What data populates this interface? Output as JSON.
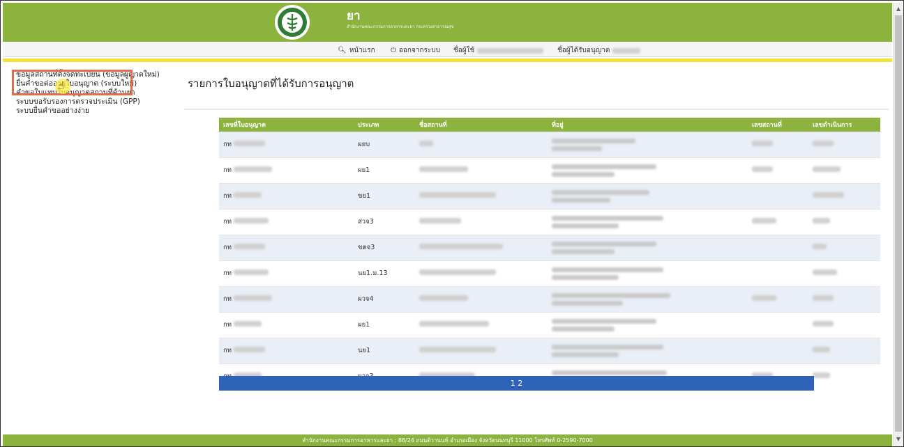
{
  "header": {
    "title": "ยา",
    "subtitle": "สำนักงานคณะกรรมการอาหารและยา กระทรวงสาธารณสุข"
  },
  "nav": {
    "home": "หน้าแรก",
    "logout": "ออกจากระบบ",
    "user_label": "ชื่อผู้ใช้",
    "licensee_label": "ชื่อผู้ได้รับอนุญาต",
    "icon_home": "search-icon",
    "icon_logout": "power-icon"
  },
  "sidebar": {
    "items": [
      {
        "label": "ข้อมูลสถานที่ตั้งจดทะเบียน (ข้อมูลผู้ญาตใหม่)"
      },
      {
        "label": "ยื่นคำขอต่ออายุใบอนุญาต (ระบบใหม่)"
      },
      {
        "label": "คำขอใบแทนใบอนุญาตสถานที่ด้านยา"
      },
      {
        "label": "ระบบขอรับรองการตรวจประเมิน (GPP)"
      },
      {
        "label": "ระบบยื่นคำขออย่างง่าย"
      }
    ]
  },
  "page_title": "รายการใบอนุญาตที่ได้รับการอนุญาต",
  "table": {
    "headers": [
      "เลขที่ใบอนุญาต",
      "ประเภท",
      "ชื่อสถานที่",
      "ที่อยู่",
      "เลขสถานที่",
      "เลขดำเนินการ"
    ],
    "rows": [
      {
        "license_prefix": "กท",
        "type": "ผยบ"
      },
      {
        "license_prefix": "กท",
        "type": "ผย1"
      },
      {
        "license_prefix": "กท",
        "type": "ขย1"
      },
      {
        "license_prefix": "กท",
        "type": "สวจ3"
      },
      {
        "license_prefix": "กท",
        "type": "ขตจ3"
      },
      {
        "license_prefix": "กท",
        "type": "นย1.ม.13"
      },
      {
        "license_prefix": "กท",
        "type": "ผวจ4"
      },
      {
        "license_prefix": "กท",
        "type": "ผย1"
      },
      {
        "license_prefix": "กท",
        "type": "นย1"
      },
      {
        "license_prefix": "กท",
        "type": "ผวจ3"
      }
    ]
  },
  "pager": {
    "pages": "1 2"
  },
  "footer": {
    "text": "สำนักงานคณะกรรมการอาหารและยา : 88/24 ถนนติวานนท์ อำเภอเมือง จังหวัดนนทบุรี 11000 โทรศัพท์ 0-2590-7000"
  },
  "colors": {
    "brand_green": "#8db33f",
    "accent_yellow": "#f2e33a",
    "pager_blue": "#2f63b8",
    "highlight": "#e36a4a"
  }
}
